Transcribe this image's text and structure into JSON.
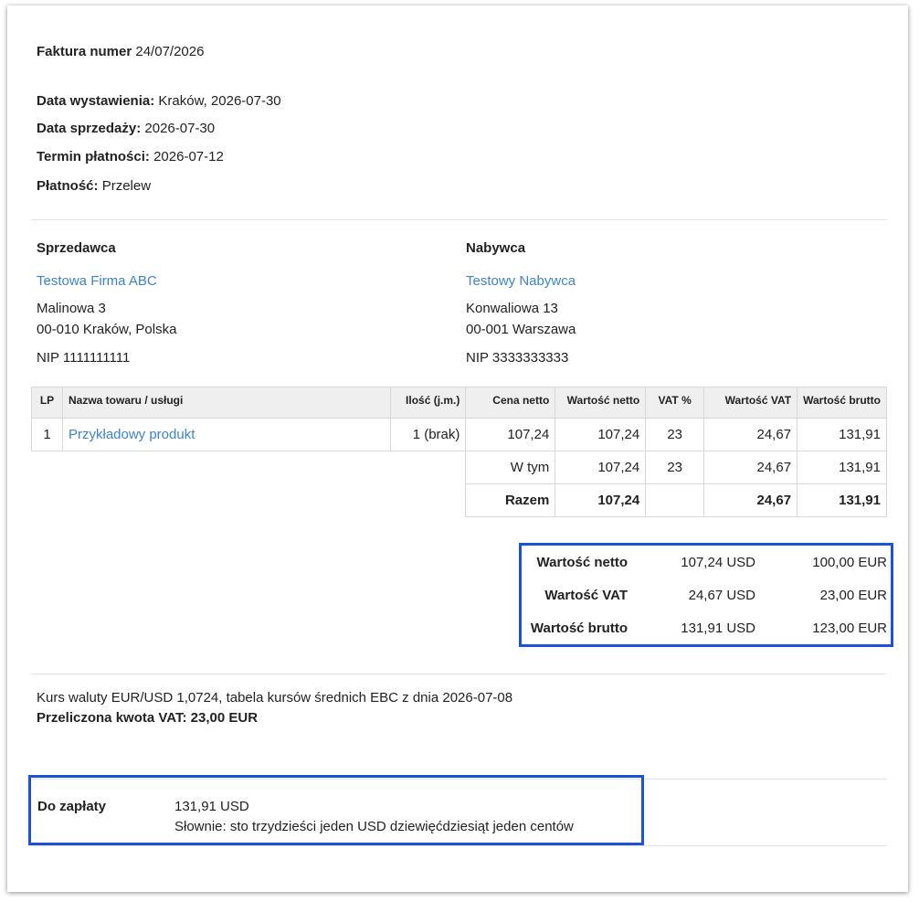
{
  "invoice": {
    "number_label": "Faktura numer",
    "number": "24/07/2026",
    "issue_date_label": "Data wystawienia:",
    "issue_date": "Kraków, 2026-07-30",
    "sale_date_label": "Data sprzedaży:",
    "sale_date": "2026-07-30",
    "due_date_label": "Termin płatności:",
    "due_date": "2026-07-12",
    "payment_label": "Płatność:",
    "payment": "Przelew"
  },
  "seller": {
    "heading": "Sprzedawca",
    "name": "Testowa Firma ABC",
    "street": "Malinowa 3",
    "city": "00-010 Kraków, Polska",
    "nip": "NIP 1111111111"
  },
  "buyer": {
    "heading": "Nabywca",
    "name": "Testowy Nabywca",
    "street": "Konwaliowa 13",
    "city": "00-001 Warszawa",
    "nip": "NIP 3333333333"
  },
  "items_table": {
    "headers": [
      "LP",
      "Nazwa towaru / usługi",
      "Ilość (j.m.)",
      "Cena netto",
      "Wartość netto",
      "VAT %",
      "Wartość VAT",
      "Wartość brutto"
    ],
    "rows": [
      {
        "lp": "1",
        "name": "Przykładowy produkt",
        "qty": "1 (brak)",
        "price": "107,24",
        "net": "107,24",
        "vat_rate": "23",
        "vat": "24,67",
        "gross": "131,91"
      }
    ],
    "subtotal": {
      "label": "W tym",
      "net": "107,24",
      "vat_rate": "23",
      "vat": "24,67",
      "gross": "131,91"
    },
    "total": {
      "label": "Razem",
      "net": "107,24",
      "vat": "24,67",
      "gross": "131,91"
    }
  },
  "currency_summary": {
    "rows": [
      {
        "label": "Wartość netto",
        "usd": "107,24 USD",
        "eur": "100,00 EUR"
      },
      {
        "label": "Wartość VAT",
        "usd": "24,67 USD",
        "eur": "23,00 EUR"
      },
      {
        "label": "Wartość brutto",
        "usd": "131,91 USD",
        "eur": "123,00 EUR"
      }
    ],
    "border_color": "#1a53d6"
  },
  "exchange": {
    "rate_text": "Kurs waluty EUR/USD 1,0724, tabela kursów średnich EBC z dnia 2026-07-08",
    "converted_vat": "Przeliczona kwota VAT: 23,00 EUR"
  },
  "payment_due": {
    "label": "Do zapłaty",
    "amount": "131,91 USD",
    "in_words": "Słownie: sto trzydzieści jeden USD dziewięćdziesiąt jeden centów"
  },
  "colors": {
    "link": "#3d85c6",
    "highlight_border": "#1a53d6"
  }
}
